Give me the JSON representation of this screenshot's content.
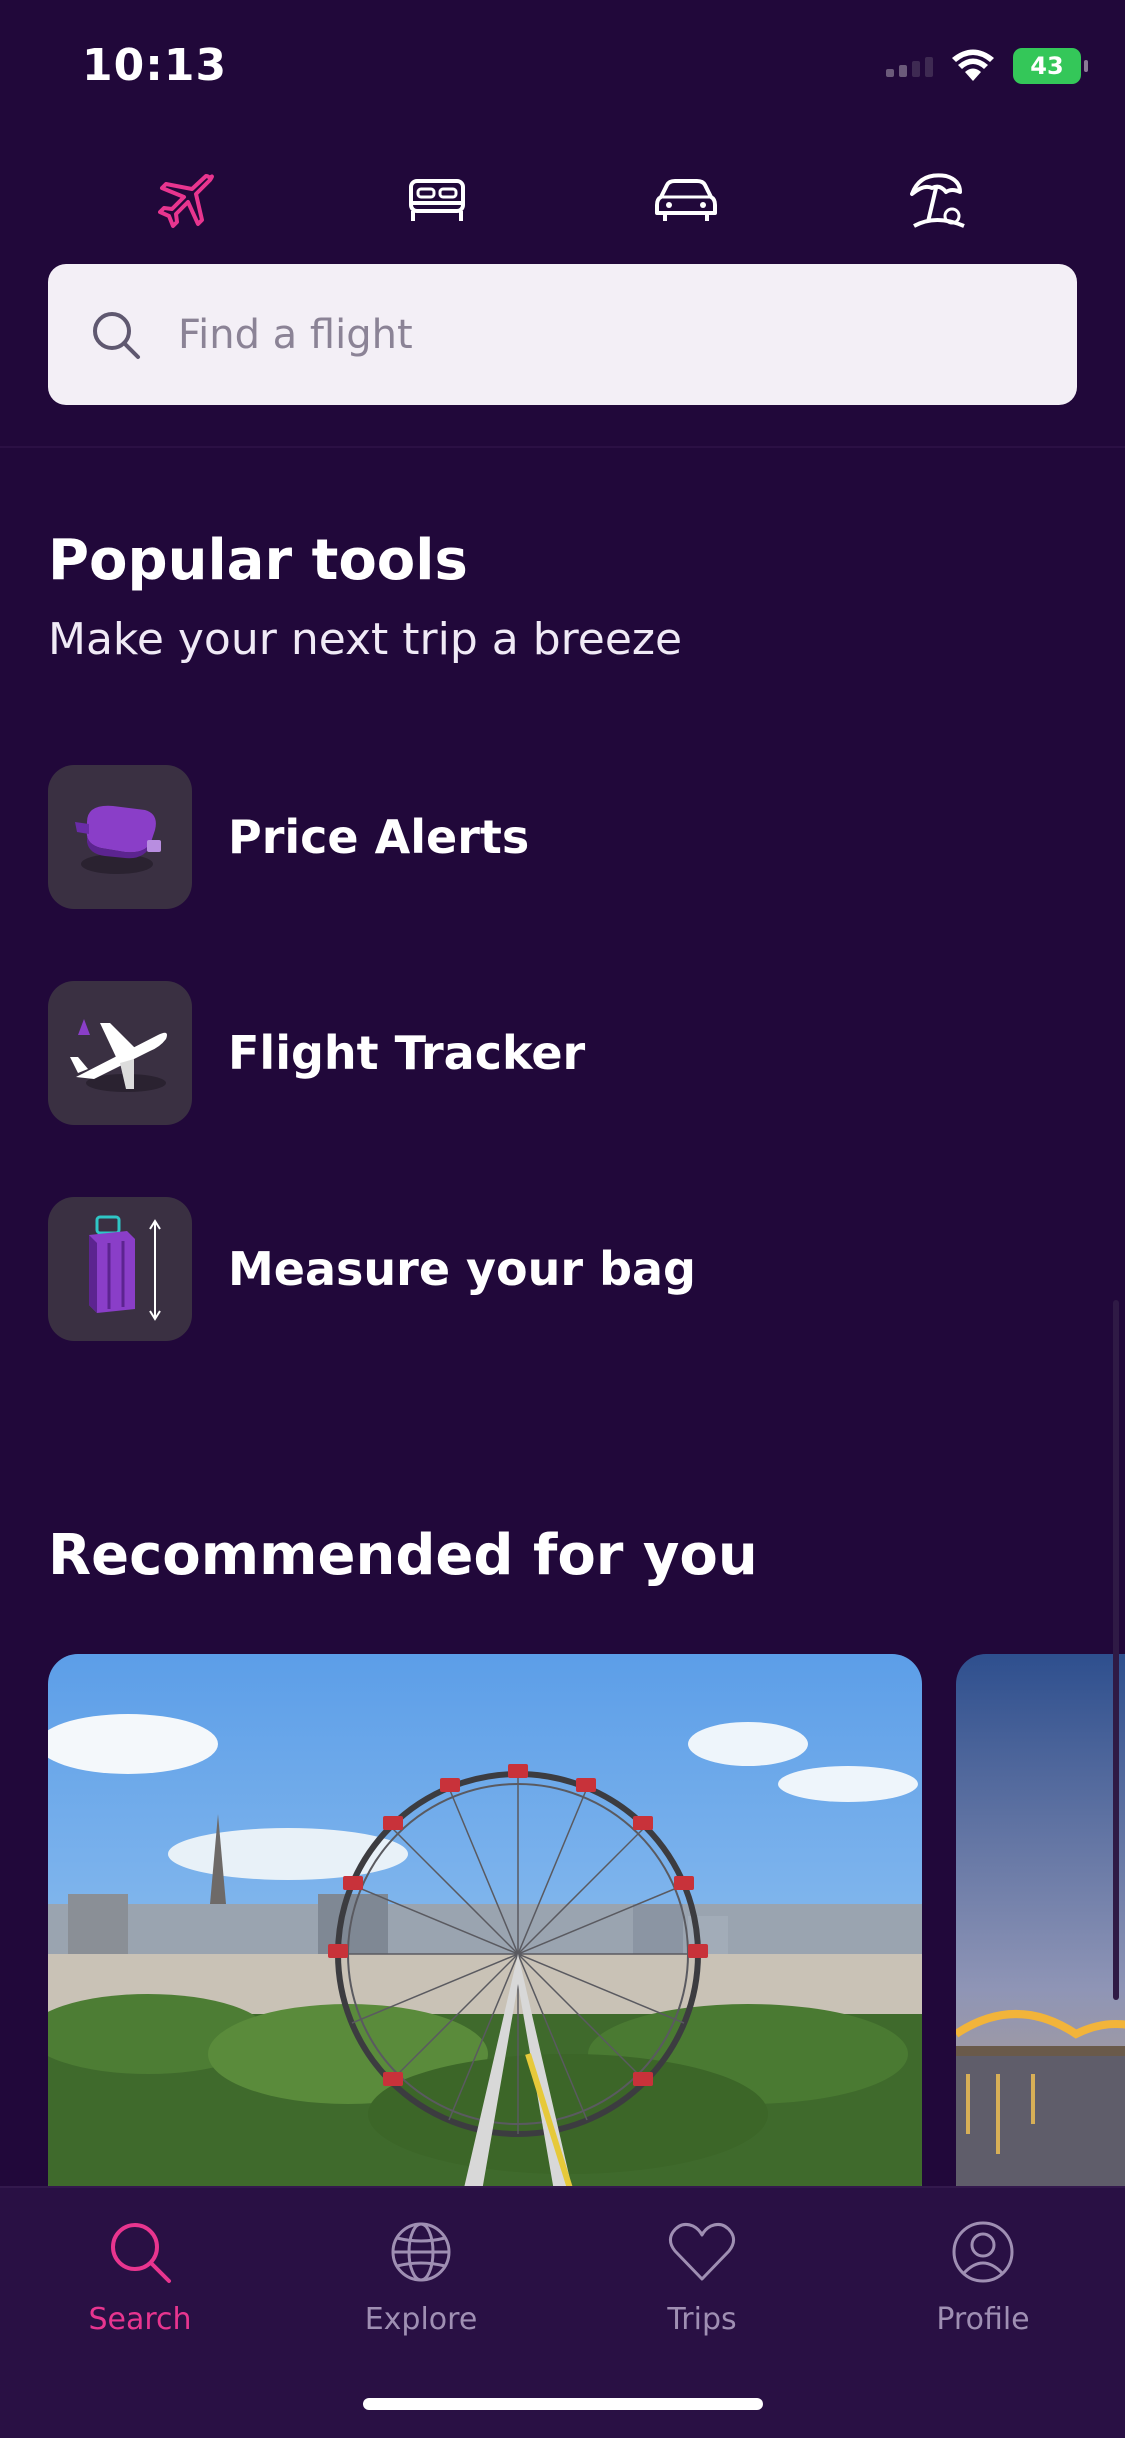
{
  "status_bar": {
    "time": "10:13",
    "battery": "43"
  },
  "categories": [
    {
      "name": "flights",
      "icon": "plane-icon",
      "active": true
    },
    {
      "name": "hotels",
      "icon": "bed-icon",
      "active": false
    },
    {
      "name": "cars",
      "icon": "car-icon",
      "active": false
    },
    {
      "name": "packages",
      "icon": "beach-umbrella-icon",
      "active": false
    }
  ],
  "search": {
    "placeholder": "Find a flight"
  },
  "popular_tools": {
    "title": "Popular tools",
    "subtitle": "Make your next trip a breeze",
    "items": [
      {
        "label": "Price Alerts",
        "icon": "price-alert-icon"
      },
      {
        "label": "Flight Tracker",
        "icon": "flight-tracker-icon"
      },
      {
        "label": "Measure your bag",
        "icon": "suitcase-icon"
      }
    ]
  },
  "recommended": {
    "title": "Recommended for you"
  },
  "tab_bar": {
    "items": [
      {
        "label": "Search",
        "icon": "search-icon",
        "active": true
      },
      {
        "label": "Explore",
        "icon": "globe-icon",
        "active": false
      },
      {
        "label": "Trips",
        "icon": "heart-icon",
        "active": false
      },
      {
        "label": "Profile",
        "icon": "profile-icon",
        "active": false
      }
    ]
  },
  "colors": {
    "background": "#21083a",
    "accent": "#e8358f",
    "tab_bar": "#291044",
    "search_bg": "#f3eff6"
  }
}
